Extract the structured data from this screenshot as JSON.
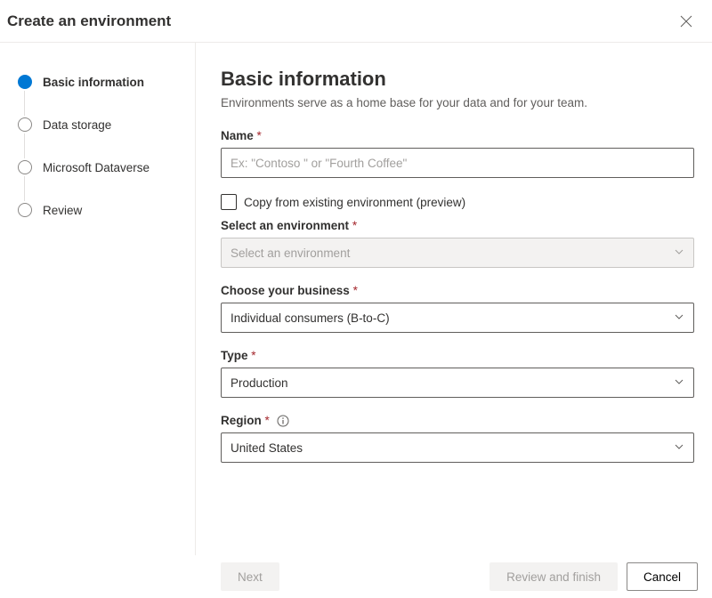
{
  "header": {
    "title": "Create an environment"
  },
  "steps": [
    {
      "label": "Basic information"
    },
    {
      "label": "Data storage"
    },
    {
      "label": "Microsoft Dataverse"
    },
    {
      "label": "Review"
    }
  ],
  "main": {
    "heading": "Basic information",
    "subtitle": "Environments serve as a home base for your data and for your team.",
    "name_label": "Name",
    "name_placeholder": "Ex: \"Contoso \" or \"Fourth Coffee\"",
    "copy_label": "Copy from existing environment (preview)",
    "select_env_label": "Select an environment",
    "select_env_placeholder": "Select an environment",
    "business_label": "Choose your business",
    "business_value": "Individual consumers (B-to-C)",
    "type_label": "Type",
    "type_value": "Production",
    "region_label": "Region",
    "region_value": "United States"
  },
  "footer": {
    "next": "Next",
    "review": "Review and finish",
    "cancel": "Cancel"
  }
}
